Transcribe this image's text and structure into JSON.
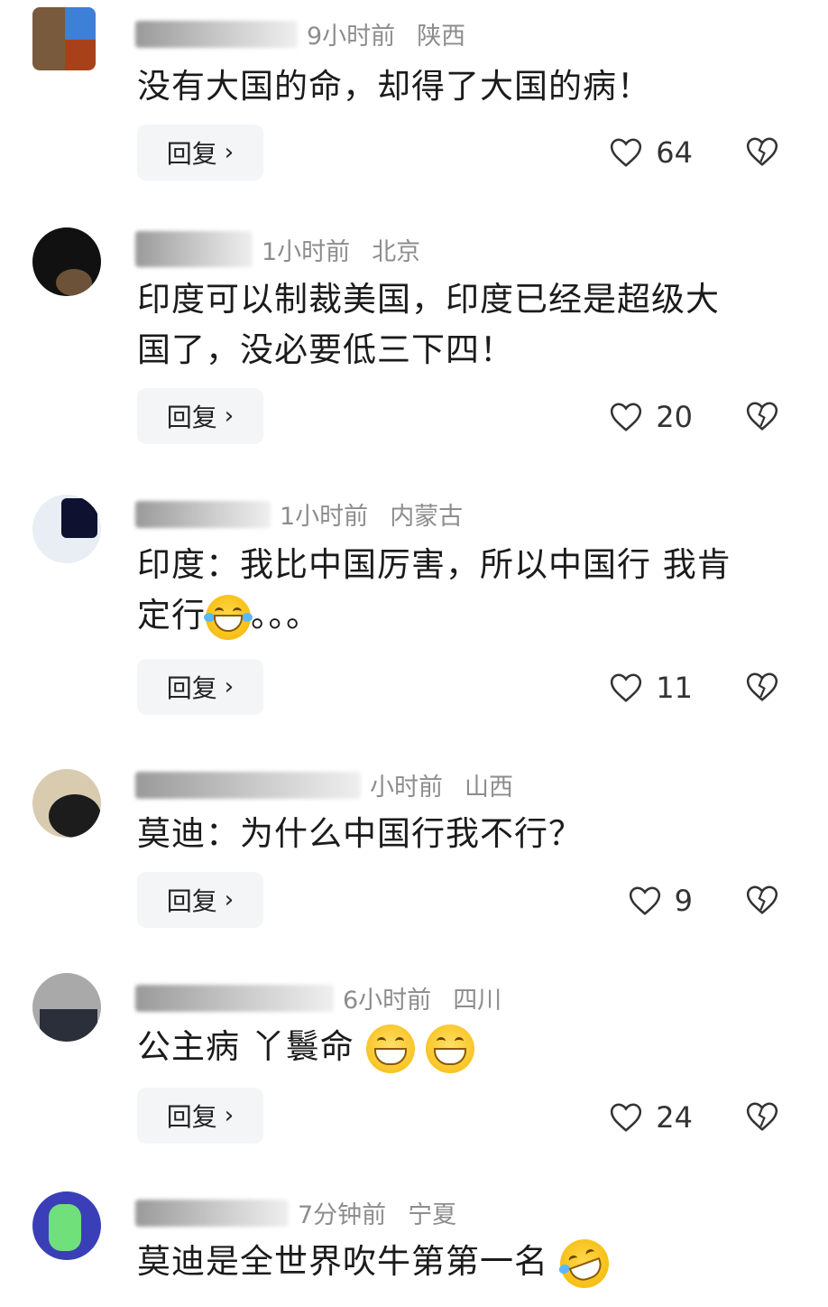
{
  "reply_label": "回复",
  "comments": [
    {
      "meta_time": "9小时前",
      "meta_loc": "陕西",
      "text": "没有大国的命，却得了大国的病！",
      "likes": "64"
    },
    {
      "meta_time": "1小时前",
      "meta_loc": "北京",
      "text_line1": "印度可以制裁美国，印度已经是超级大",
      "text_line2": "国了，没必要低三下四！",
      "likes": "20"
    },
    {
      "meta_time": "1小时前",
      "meta_loc": "内蒙古",
      "text_line1": "印度：我比中国厉害，所以中国行 我肯",
      "text_line2a": "定行",
      "text_line2b": "。。。",
      "likes": "11"
    },
    {
      "meta_time": "小时前",
      "meta_loc": "山西",
      "text": "莫迪：为什么中国行我不行？",
      "likes": "9"
    },
    {
      "meta_time": "6小时前",
      "meta_loc": "四川",
      "text": "公主病 丫鬟命",
      "likes": "24"
    },
    {
      "meta_time": "7分钟前",
      "meta_loc": "宁夏",
      "text": "莫迪是全世界吹牛第第一名"
    }
  ],
  "icons": {
    "like": "heart-outline-icon",
    "dislike": "broken-heart-icon",
    "chevron": "chevron-right-icon"
  }
}
